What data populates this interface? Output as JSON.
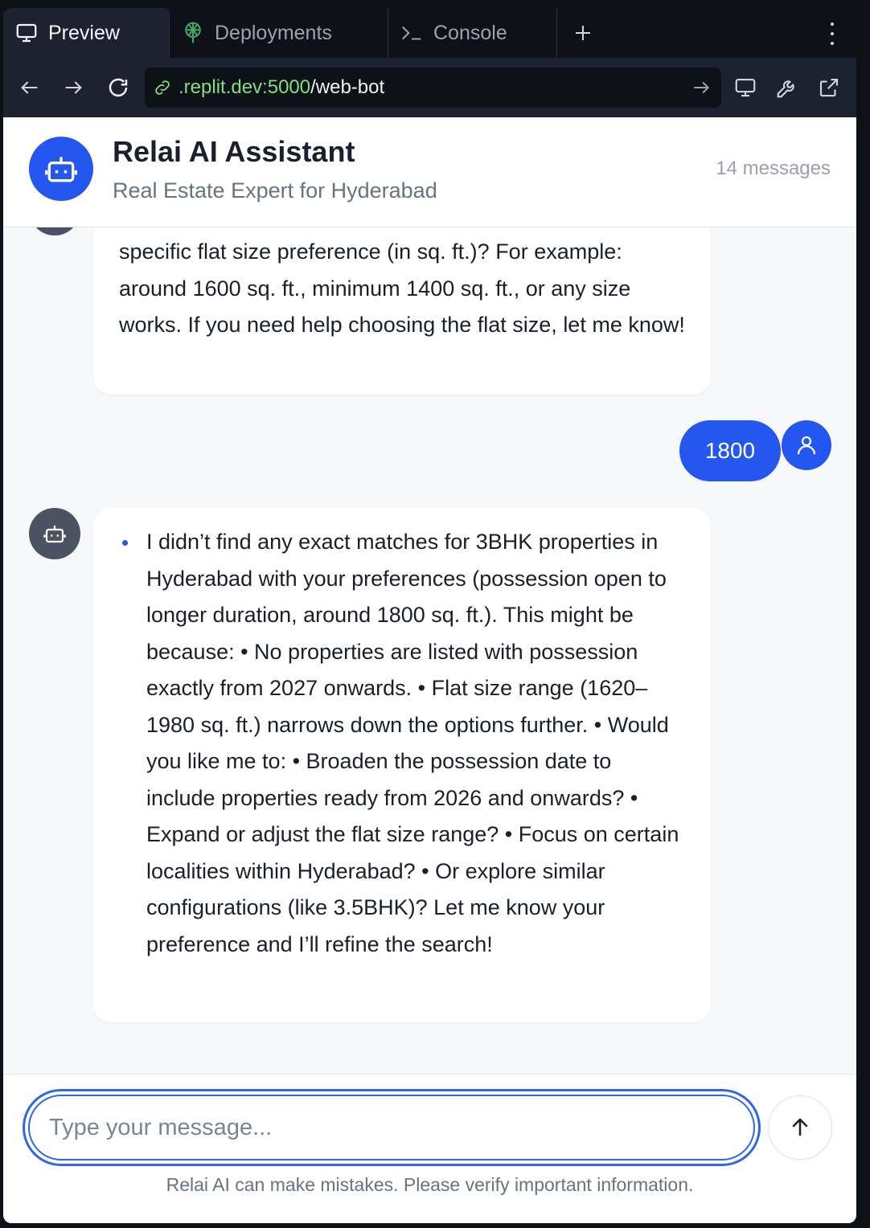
{
  "tabs": [
    {
      "label": "Preview",
      "icon": "monitor-icon",
      "active": true
    },
    {
      "label": "Deployments",
      "icon": "deploy-icon",
      "active": false
    },
    {
      "label": "Console",
      "icon": "terminal-icon",
      "active": false
    }
  ],
  "url": {
    "prefix": ".replit.dev:5000",
    "path": "/web-bot"
  },
  "header": {
    "title": "Relai AI Assistant",
    "subtitle": "Real Estate Expert for Hyderabad",
    "count": "14 messages"
  },
  "messages": [
    {
      "role": "bot",
      "text": "specific flat size preference (in sq. ft.)? For example: around 1600 sq. ft., minimum 1400 sq. ft., or any size works. If you need help choosing the flat size, let me know!"
    },
    {
      "role": "user",
      "text": "1800"
    },
    {
      "role": "bot",
      "text": "I didn’t find any exact matches for 3BHK properties in Hyderabad with your preferences (possession open to longer duration, around 1800 sq. ft.). This might be because: • No properties are listed with possession exactly from 2027 onwards. • Flat size range (1620–1980 sq. ft.) narrows down the options further. • Would you like me to: • Broaden the possession date to include properties ready from 2026 and onwards? • Expand or adjust the flat size range? • Focus on certain localities within Hyderabad? • Or explore similar configurations (like 3.5BHK)? Let me know your preference and I’ll refine the search!"
    }
  ],
  "composer": {
    "placeholder": "Type your message...",
    "disclaimer": "Relai AI can make mistakes. Please verify important information."
  },
  "colors": {
    "accent": "#2456f0",
    "bot_avatar": "#4b5261",
    "url_green": "#7ee081"
  }
}
